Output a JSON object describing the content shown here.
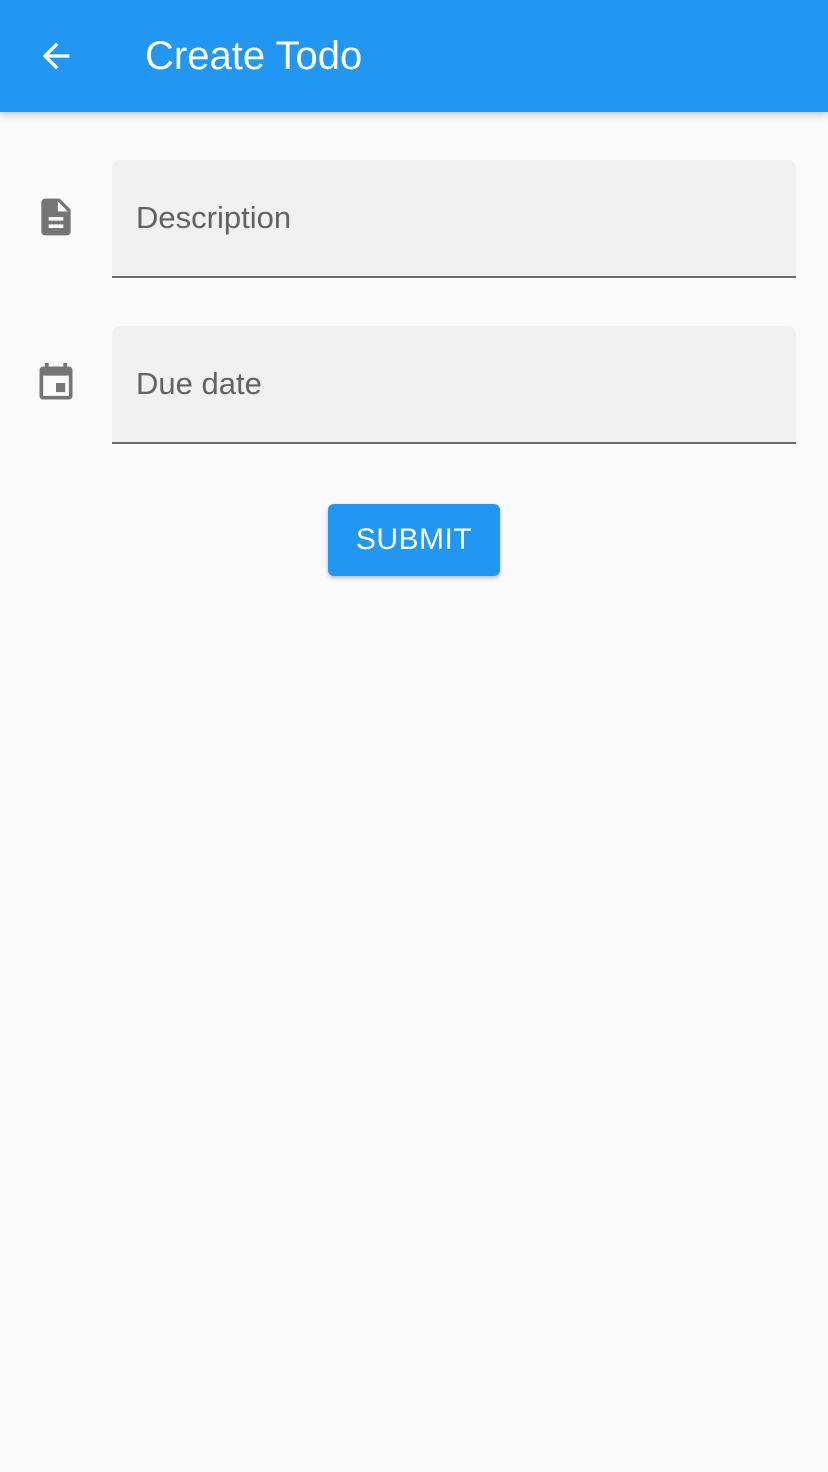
{
  "appbar": {
    "title": "Create Todo",
    "back_icon": "arrow-back-icon",
    "color": "#2196f3"
  },
  "form": {
    "description": {
      "icon": "document-icon",
      "placeholder": "Description",
      "value": ""
    },
    "due_date": {
      "icon": "calendar-icon",
      "placeholder": "Due date",
      "value": ""
    },
    "submit_label": "SUBMIT"
  },
  "colors": {
    "primary": "#2196f3",
    "background": "#fafafa",
    "field_fill": "#f0f0f0",
    "icon_gray": "#757575"
  }
}
